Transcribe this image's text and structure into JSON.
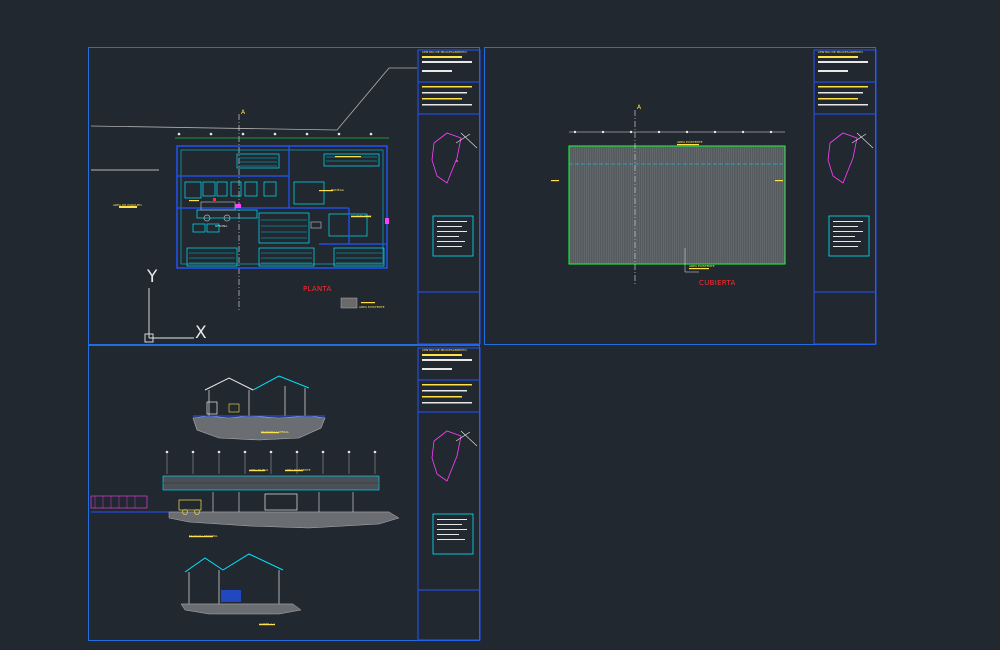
{
  "sheets": {
    "plan": {
      "title": "PLANTA",
      "grid_axis": "A",
      "ucs_x": "X",
      "ucs_y": "Y",
      "labels": [
        "AREA DE PARQUEO",
        "AREA EXISTENTE",
        "OFICINA",
        "BODEGA",
        "CUARTO FRIO"
      ]
    },
    "roof": {
      "title": "CUBIERTA",
      "grid_axis": "A",
      "labels": [
        "AREA EXISTENTE",
        "AREA EXISTENTE"
      ]
    },
    "sections": {
      "labels": [
        "FACHADA LATERAL",
        "FACHADA FRONTAL",
        "CORTE A-A",
        "AREA NUEVA",
        "AREA EXISTENTE"
      ]
    }
  },
  "title_block": {
    "project_heading": "PROYECTO",
    "project_name": "CENTRO DE PROCESAMIENTO",
    "sheet_name_plan": "PLANTA",
    "sheet_name_roof": "CUBIERTA",
    "sheet_name_sections": "CORTES Y FACHADAS"
  },
  "colors": {
    "background": "#212830",
    "sheet_border": "#1f6fe0",
    "cad_cyan": "#00e5ff",
    "cad_blue": "#2255ff",
    "cad_yellow": "#ffe14a",
    "cad_red": "#ff2d2d",
    "cad_white": "#e8e8e8",
    "cad_green": "#20ff40",
    "cad_magenta": "#ff40ff"
  }
}
